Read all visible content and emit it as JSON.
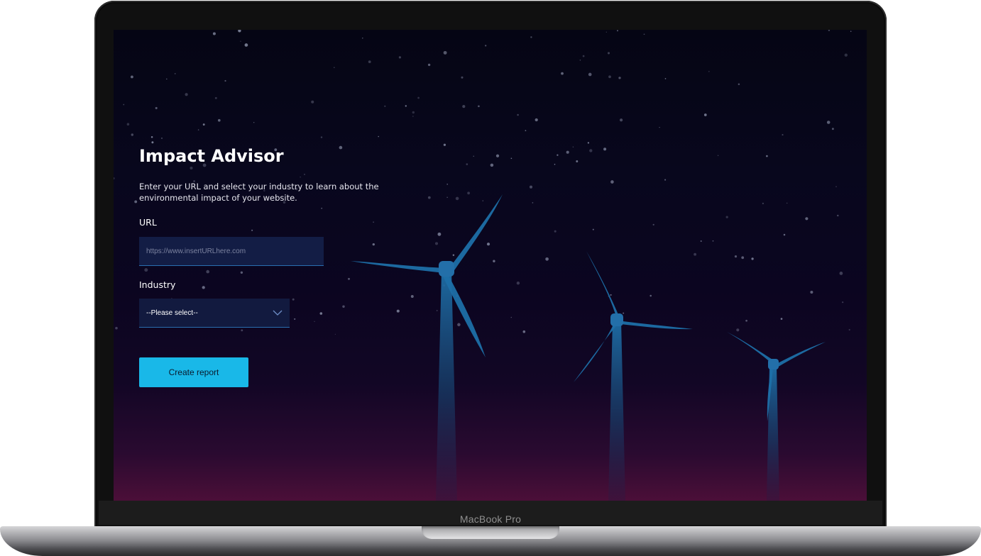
{
  "device": {
    "brand_label": "MacBook Pro"
  },
  "app": {
    "title": "Impact Advisor",
    "description": "Enter your URL and select your industry to learn about the environmental impact of your website."
  },
  "form": {
    "url_label": "URL",
    "url_value": "",
    "url_placeholder": "https://www.insertURLhere.com",
    "industry_label": "Industry",
    "industry_selected": "--Please select--",
    "submit_label": "Create report"
  },
  "colors": {
    "accent": "#19b8e8",
    "turbine": "#1e6fa8",
    "input_bg": "#131d45",
    "sky_top": "#050514",
    "sky_bottom": "#4b0f38"
  },
  "icons": {
    "dropdown": "chevron-down-icon"
  }
}
